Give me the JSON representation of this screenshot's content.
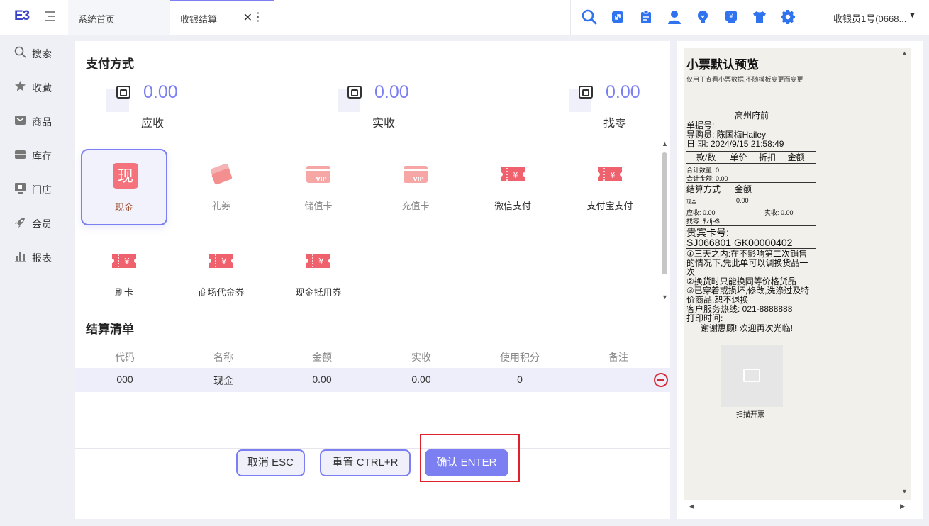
{
  "app": {
    "logo": "E3"
  },
  "tabs": {
    "home": "系统首页",
    "active": "收银结算"
  },
  "topbar": {
    "user": "收银员1号(0668..."
  },
  "sidebar": {
    "items": [
      "搜索",
      "收藏",
      "商品",
      "库存",
      "门店",
      "会员",
      "报表"
    ]
  },
  "payment": {
    "title": "支付方式",
    "receivable": {
      "value": "0.00",
      "label": "应收"
    },
    "received": {
      "value": "0.00",
      "label": "实收"
    },
    "change": {
      "value": "0.00",
      "label": "找零"
    },
    "methods": [
      "现金",
      "礼券",
      "储值卡",
      "充值卡",
      "微信支付",
      "支付宝支付",
      "刷卡",
      "商场代金券",
      "现金抵用券"
    ],
    "cash_icon_text": "现"
  },
  "settlement": {
    "title": "结算清单",
    "headers": [
      "代码",
      "名称",
      "金额",
      "实收",
      "使用积分",
      "备注"
    ],
    "rows": [
      [
        "000",
        "现金",
        "0.00",
        "0.00",
        "0",
        ""
      ]
    ]
  },
  "buttons": {
    "cancel": "取消 ESC",
    "reset": "重置 CTRL+R",
    "confirm": "确认 ENTER"
  },
  "receipt": {
    "title": "小票默认预览",
    "subtitle": "仅用于查看小票数据,不随模板变更而变更",
    "store": "高州府前",
    "doc_no": "单据号:",
    "guide": "导购员: 陈国梅Hailey",
    "date": "日    期:  2024/9/15 21:58:49",
    "cols": "款/数      单价     折扣     金额",
    "total_qty": "合计数量: 0",
    "total_amt": "合计金额: 0.00",
    "pay_head": "结算方式      金额",
    "pay_cash": "现金",
    "pay_cash_amt": "0.00",
    "receivable": "应收: 0.00",
    "received": "实收: 0.00",
    "change": "找零: $zlje$",
    "vip_label": "贵宾卡号:",
    "vip_no": "SJ066801  GK00000402",
    "notes": [
      "①三天之内:在不影响第二次销售",
      "的情况下,凭此单可以调换货品一",
      "次",
      "②换货时只能换同等价格货品",
      "③已穿着或损坏,修改,洗涤过及特",
      "价商品,恕不退换",
      "客户服务热线: 021-8888888",
      "打印时间:",
      "      谢谢惠顾! 欢迎再次光临!"
    ],
    "scan": "扫描开票"
  }
}
